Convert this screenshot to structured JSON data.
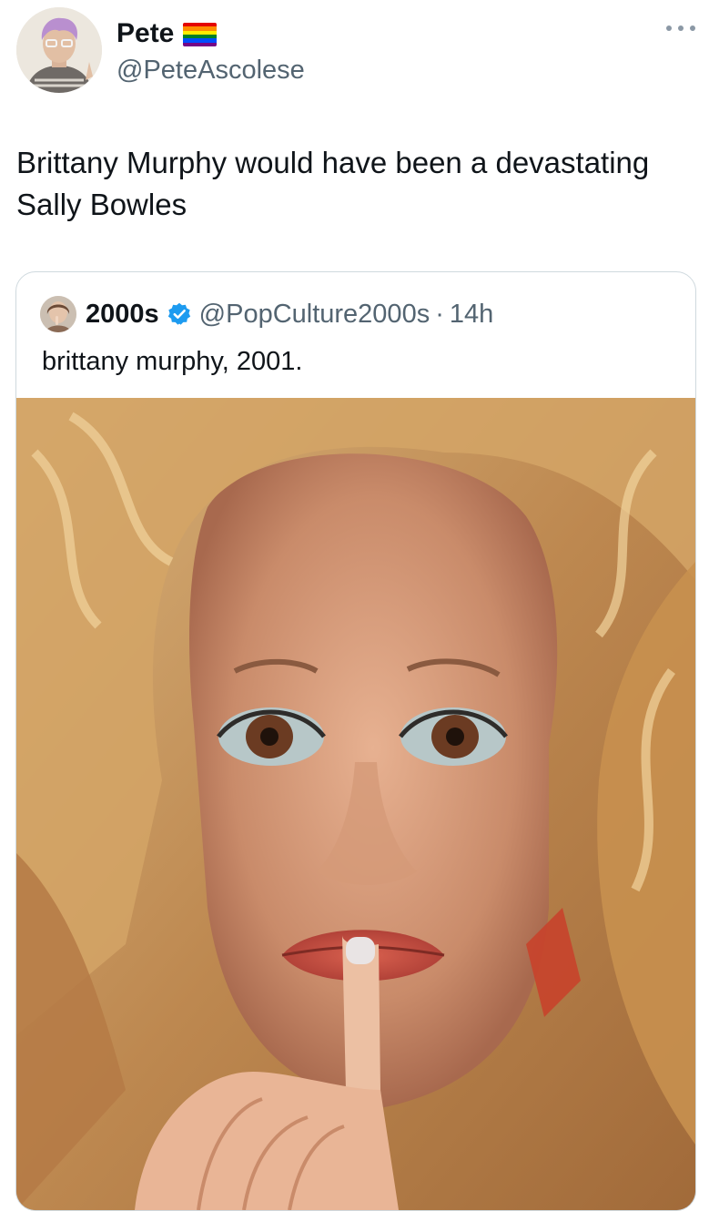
{
  "tweet": {
    "author": {
      "display_name": "Pete",
      "handle": "@PeteAscolese",
      "flag_icon": "rainbow-flag-icon",
      "flag_colors": [
        "#e40303",
        "#ff8c00",
        "#ffed00",
        "#008026",
        "#004dff",
        "#750787"
      ]
    },
    "more_icon": "more-options-icon",
    "text": "Brittany Murphy would have been a devastating Sally Bowles",
    "quoted": {
      "display_name": "2000s",
      "verified_icon": "verified-badge-icon",
      "verified_color": "#1d9bf0",
      "handle": "@PopCulture2000s",
      "separator": "·",
      "time": "14h",
      "text": "brittany murphy, 2001.",
      "media_icon": "photo-portrait"
    }
  }
}
